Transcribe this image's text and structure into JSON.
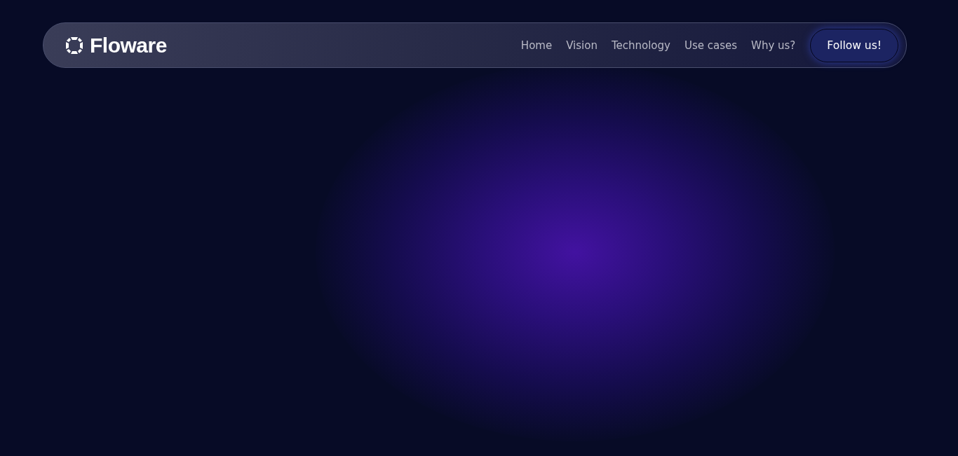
{
  "header": {
    "logo": "Floware",
    "nav": [
      {
        "label": "Home"
      },
      {
        "label": "Vision"
      },
      {
        "label": "Technology"
      },
      {
        "label": "Use cases"
      },
      {
        "label": "Why us?"
      }
    ],
    "cta": "Follow us!"
  }
}
